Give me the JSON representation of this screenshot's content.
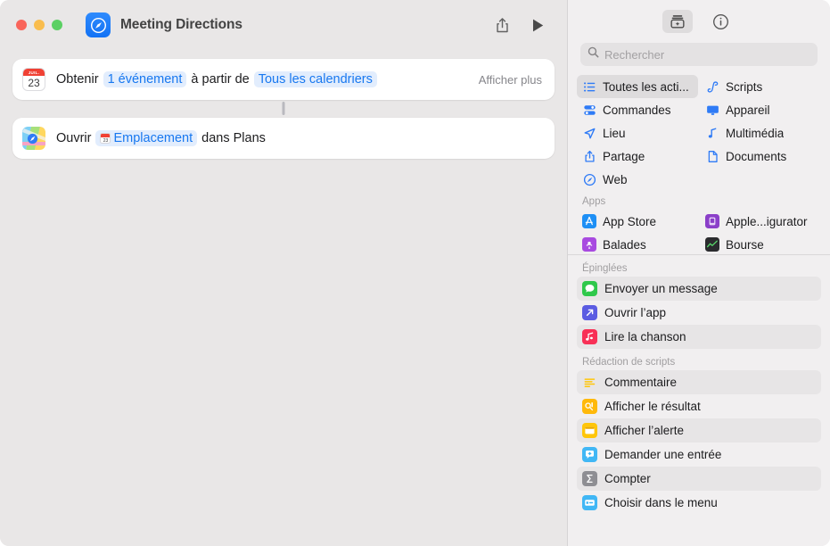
{
  "window": {
    "title": "Meeting Directions",
    "doc_icon": "safari-compass-icon"
  },
  "toolbar": {
    "share_icon": "share-icon",
    "run_icon": "play-icon",
    "traffic": [
      "close",
      "minimize",
      "zoom"
    ]
  },
  "editor": {
    "actions": [
      {
        "icon": "calendar-app-icon",
        "icon_month": "JUIL.",
        "icon_day": "23",
        "prefix": "Obtenir",
        "token1": "1 événement",
        "mid": "à partir de",
        "token2": "Tous les calendriers",
        "trailing": "Afficher plus"
      },
      {
        "icon": "maps-app-icon",
        "prefix": "Ouvrir",
        "token1": "Emplacement",
        "token1_icon": "calendar-token-icon",
        "suffix": "dans Plans"
      }
    ]
  },
  "sidebar": {
    "toolbar": {
      "library_icon": "action-library-icon",
      "info_icon": "info-circle-icon"
    },
    "search": {
      "placeholder": "Rechercher",
      "value": "",
      "icon": "search-icon"
    },
    "categories": [
      {
        "label": "Toutes les acti...",
        "icon": "list-bullet-icon",
        "selected": true
      },
      {
        "label": "Scripts",
        "icon": "scroll-icon",
        "selected": false
      },
      {
        "label": "Commandes",
        "icon": "sliders-icon",
        "selected": false
      },
      {
        "label": "Appareil",
        "icon": "display-icon",
        "selected": false
      },
      {
        "label": "Lieu",
        "icon": "location-arrow-icon",
        "selected": false
      },
      {
        "label": "Multimédia",
        "icon": "music-note-icon",
        "selected": false
      },
      {
        "label": "Partage",
        "icon": "share-icon",
        "selected": false
      },
      {
        "label": "Documents",
        "icon": "document-icon",
        "selected": false
      },
      {
        "label": "Web",
        "icon": "safari-compass-icon",
        "selected": false
      }
    ],
    "apps_header": "Apps",
    "apps": [
      {
        "label": "App Store",
        "icon": "app-store-icon",
        "color": "#1e8ff5"
      },
      {
        "label": "Apple...igurator",
        "icon": "apple-configurator-icon",
        "color": "#8b3fc9"
      },
      {
        "label": "Balades",
        "icon": "podcasts-icon",
        "color": "#a84ae0"
      },
      {
        "label": "Bourse",
        "icon": "stocks-icon",
        "color": "#2b2b2e"
      }
    ],
    "pinned_header": "Épinglées",
    "pinned": [
      {
        "label": "Envoyer un message",
        "icon": "messages-icon",
        "color": "#2fc84b"
      },
      {
        "label": "Ouvrir l’app",
        "icon": "open-app-icon",
        "color": "#5b5ce2"
      },
      {
        "label": "Lire la chanson",
        "icon": "music-icon",
        "color": "#f83056"
      }
    ],
    "scripting_header": "Rédaction de scripts",
    "scripting": [
      {
        "label": "Commentaire",
        "icon": "comment-lines-icon",
        "color": "#ffffff"
      },
      {
        "label": "Afficher le résultat",
        "icon": "quicklook-icon",
        "color": "#ffb90a"
      },
      {
        "label": "Afficher l’alerte",
        "icon": "alert-window-icon",
        "color": "#ffc60a"
      },
      {
        "label": "Demander une entrée",
        "icon": "ask-input-icon",
        "color": "#41b7f5"
      },
      {
        "label": "Compter",
        "icon": "sigma-count-icon",
        "color": "#8e8e93"
      },
      {
        "label": "Choisir dans le menu",
        "icon": "choose-menu-icon",
        "color": "#41b7f5"
      }
    ]
  },
  "colors": {
    "accent": "#1878f0",
    "token_bg": "#e2edfd",
    "canvas_bg": "#e9e7e7",
    "sidebar_bg": "#f1eff0"
  }
}
